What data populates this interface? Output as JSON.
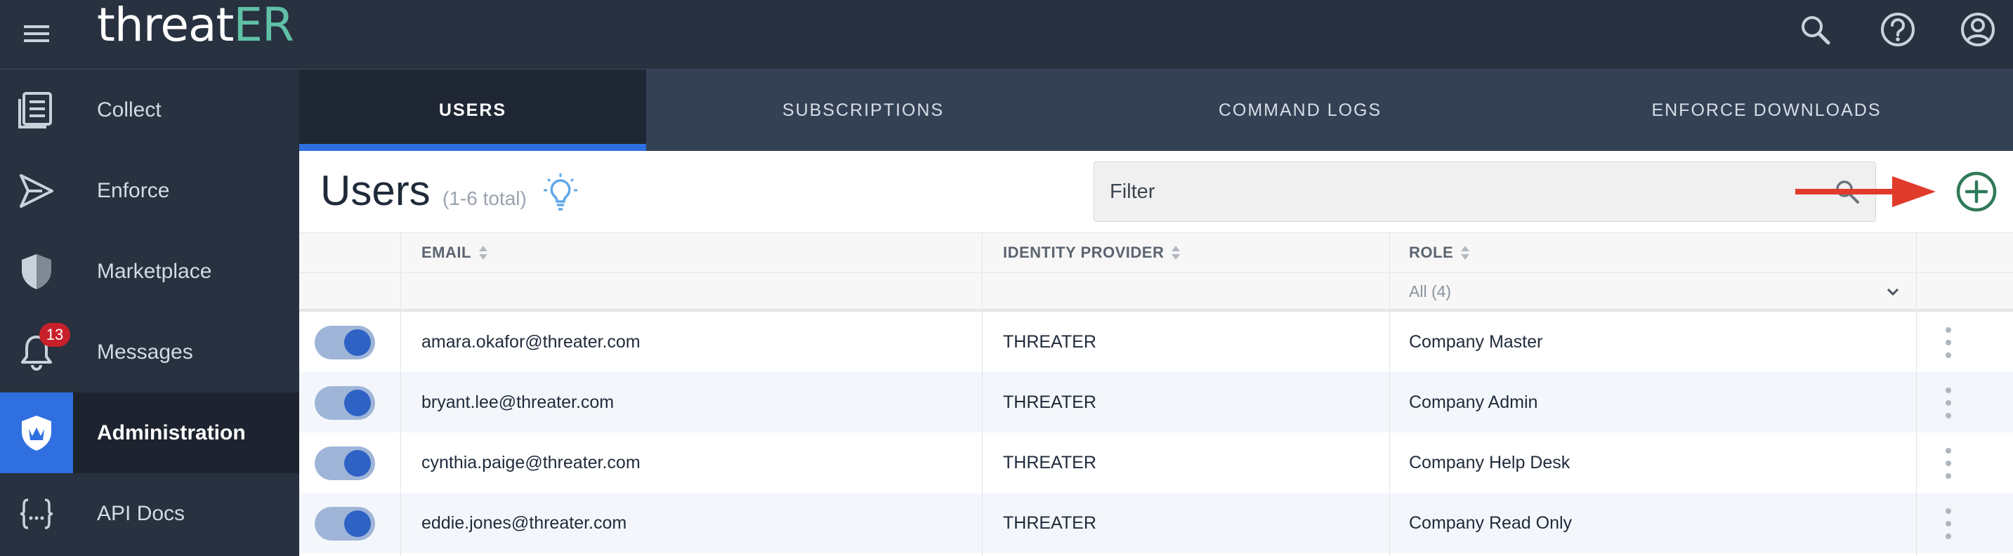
{
  "app": {
    "logo_main": "threat",
    "logo_accent": "ER",
    "logo_main_prefix": "threa",
    "logo_letter_t": "t"
  },
  "colors": {
    "sidebar_bg": "#28313f",
    "accent_blue": "#2f6fe0",
    "logo_green": "#5fc0a6",
    "add_green": "#2f7a5a",
    "badge_red": "#c8202a",
    "annotation_arrow": "#e03a2a"
  },
  "topbar": {
    "icons": [
      "menu-icon",
      "search-icon",
      "help-icon",
      "account-icon"
    ]
  },
  "sidebar": {
    "items": [
      {
        "label": "Collect",
        "icon": "collect-list-icon"
      },
      {
        "label": "Enforce",
        "icon": "enforce-send-icon"
      },
      {
        "label": "Marketplace",
        "icon": "shield-icon"
      },
      {
        "label": "Messages",
        "icon": "bell-icon",
        "badge": "13"
      },
      {
        "label": "Administration",
        "icon": "admin-shield-crown-icon",
        "active": true
      },
      {
        "label": "API Docs",
        "icon": "braces-icon"
      }
    ]
  },
  "tabs": [
    {
      "label": "USERS",
      "active": true
    },
    {
      "label": "SUBSCRIPTIONS"
    },
    {
      "label": "COMMAND LOGS"
    },
    {
      "label": "ENFORCE DOWNLOADS"
    }
  ],
  "page": {
    "title": "Users",
    "count": "(1-6 total)"
  },
  "filter": {
    "placeholder": "Filter"
  },
  "table": {
    "headers": {
      "email": "EMAIL",
      "identity_provider": "IDENTITY PROVIDER",
      "role": "ROLE"
    },
    "role_filter": "All (4)",
    "rows": [
      {
        "enabled": true,
        "email": "amara.okafor@threater.com",
        "provider": "THREATER",
        "role": "Company Master"
      },
      {
        "enabled": true,
        "email": "bryant.lee@threater.com",
        "provider": "THREATER",
        "role": "Company Admin"
      },
      {
        "enabled": true,
        "email": "cynthia.paige@threater.com",
        "provider": "THREATER",
        "role": "Company Help Desk"
      },
      {
        "enabled": true,
        "email": "eddie.jones@threater.com",
        "provider": "THREATER",
        "role": "Company Read Only"
      }
    ]
  }
}
